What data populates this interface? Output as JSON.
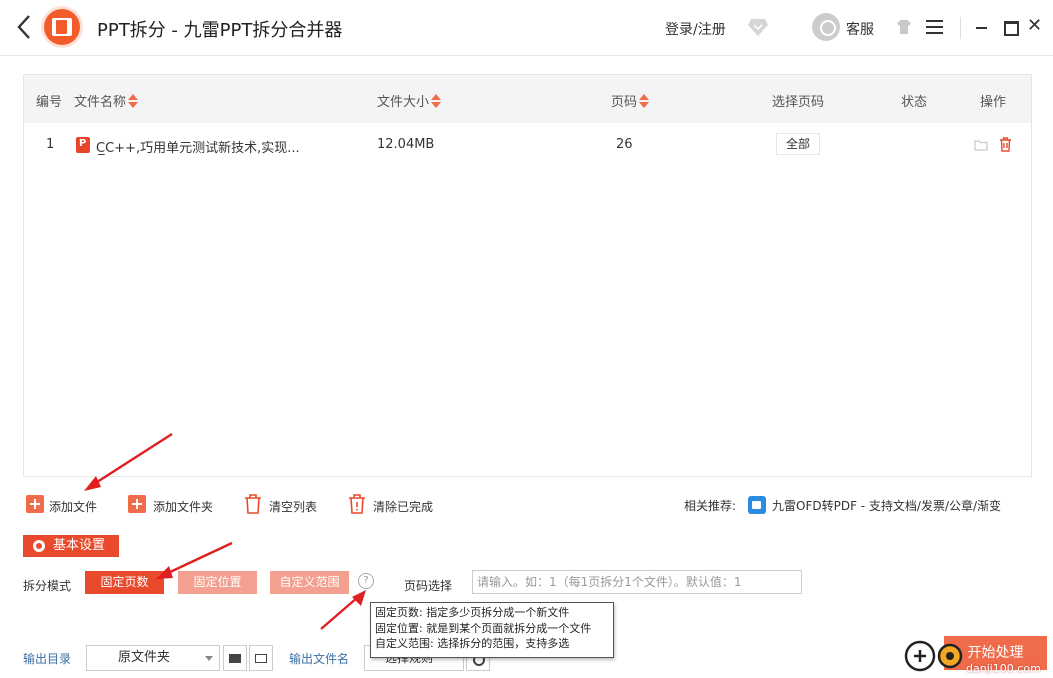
{
  "titlebar": {
    "title": "PPT拆分 - 九雷PPT拆分合并器",
    "login_label": "登录/注册",
    "service_label": "客服"
  },
  "table": {
    "headers": {
      "index": "编号",
      "file_name": "文件名称",
      "file_size": "文件大小",
      "pages": "页码",
      "select_pages": "选择页码",
      "status": "状态",
      "actions": "操作"
    },
    "rows": [
      {
        "index": "1",
        "file_name": "C̲C++,巧用单元测试新技术,实现...",
        "file_size": "12.04MB",
        "pages": "26",
        "select_pages": "全部",
        "status": ""
      }
    ]
  },
  "toolbar": {
    "add_file": "添加文件",
    "add_folder": "添加文件夹",
    "clear_list": "清空列表",
    "clear_done": "清除已完成",
    "recommend_label": "相关推荐:",
    "recommend_link": "九雷OFD转PDF - 支持文档/发票/公章/渐变"
  },
  "settings": {
    "section_label": "基本设置",
    "split_mode_label": "拆分模式",
    "modes": [
      "固定页数",
      "固定位置",
      "自定义范围"
    ],
    "selected_mode": "固定页数",
    "page_select_label": "页码选择",
    "page_input_placeholder": "请输入。如：1（每1页拆分1个文件）。默认值：1",
    "help_glyph": "?",
    "tooltip_lines": [
      "固定页数: 指定多少页拆分成一个新文件",
      "固定位置: 就是到某个页面就拆分成一个文件",
      "自定义范围: 选择拆分的范围，支持多选"
    ]
  },
  "output": {
    "dir_label": "输出目录",
    "dir_value": "原文件夹",
    "name_label": "输出文件名",
    "name_value": "选择规则"
  },
  "actions": {
    "start_label": "开始处理"
  },
  "watermark": {
    "text": "danji100.com"
  },
  "colors": {
    "accent": "#e94a2c",
    "accent_light": "#f4a090",
    "arrow": "#e02020"
  },
  "icons": [
    "back-icon",
    "app-logo",
    "vip-diamond-icon",
    "avatar",
    "shirt-icon",
    "menu-icon",
    "minimize-icon",
    "maximize-icon",
    "close-icon",
    "ppt-file-icon",
    "open-folder-icon",
    "delete-icon",
    "add-file-icon",
    "add-folder-icon",
    "trash-icon",
    "clear-done-icon",
    "ofd-icon",
    "gear-icon",
    "help-icon",
    "folder-icon"
  ]
}
